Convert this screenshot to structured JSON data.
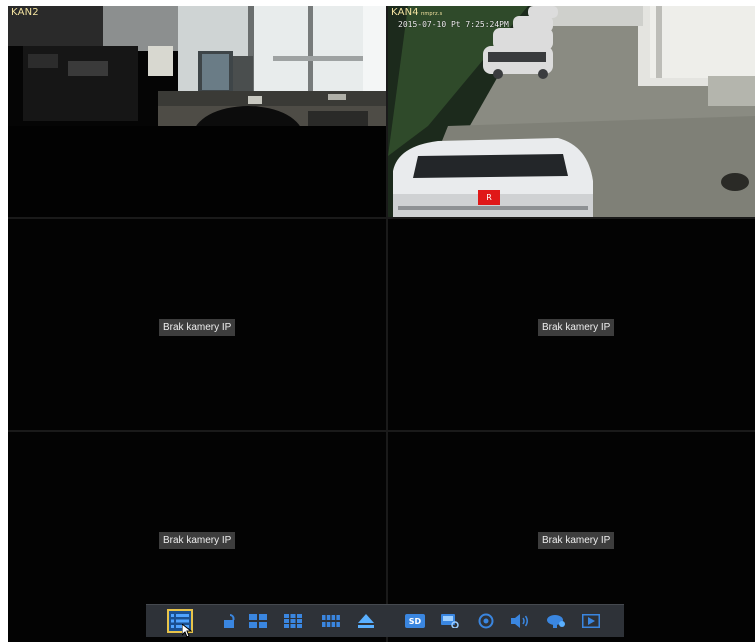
{
  "cameras": {
    "kan2": {
      "label": "KAN2"
    },
    "kan4": {
      "label": "KAN4",
      "label_suffix": "пmprz.s",
      "timestamp": "2015-07-10 Pt 7:25:24PM",
      "recording_badge": "R"
    }
  },
  "empty_channels": [
    {
      "text": "Brak kamery IP"
    },
    {
      "text": "Brak kamery IP"
    },
    {
      "text": "Brak kamery IP"
    },
    {
      "text": "Brak kamery IP"
    }
  ],
  "toolbar": {
    "items": [
      {
        "name": "main-menu",
        "icon": "list-icon"
      },
      {
        "name": "lock",
        "icon": "lock-icon"
      },
      {
        "name": "layout-4",
        "icon": "grid-4-icon"
      },
      {
        "name": "layout-9",
        "icon": "grid-9-icon"
      },
      {
        "name": "layout-16",
        "icon": "grid-16-icon"
      },
      {
        "name": "eject",
        "icon": "eject-icon"
      },
      {
        "name": "sd-storage",
        "icon": "sd-icon",
        "label": "SD"
      },
      {
        "name": "playback-search",
        "icon": "playback-icon"
      },
      {
        "name": "record",
        "icon": "record-icon"
      },
      {
        "name": "audio",
        "icon": "speaker-icon"
      },
      {
        "name": "ptz",
        "icon": "ptz-icon"
      },
      {
        "name": "play",
        "icon": "play-icon"
      }
    ]
  },
  "colors": {
    "osd_label": "#f2e2a0",
    "toolbar_bg": "#2e3238",
    "toolbar_icon": "#3a86e0",
    "active_outline": "#e8c44a",
    "rec_red": "#e01818",
    "no_cam_bg": "#3d3d3d"
  }
}
